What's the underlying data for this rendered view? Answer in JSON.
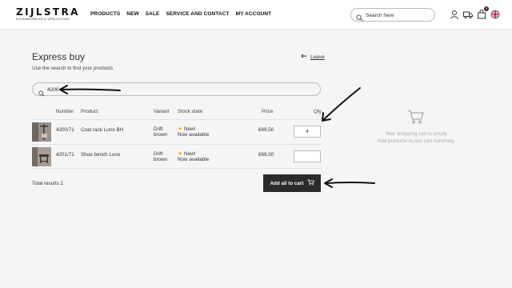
{
  "brand": {
    "name": "ZIJLSTRA",
    "tagline": "KLEINMEUBELEN & VERLICHTING"
  },
  "nav": [
    "PRODUCTS",
    "NEW",
    "SALE",
    "SERVICE AND CONTACT",
    "MY ACCOUNT"
  ],
  "header_search": {
    "placeholder": "Search here"
  },
  "header_icons": [
    "user-icon",
    "truck-icon",
    "cart-icon",
    "uk-flag-icon"
  ],
  "cart_badge": "0",
  "page": {
    "title": "Express buy",
    "subtitle": "Use the search to find your products",
    "leave_label": "Leave"
  },
  "search": {
    "value": "4200"
  },
  "table": {
    "headers": {
      "number": "Number",
      "product": "Product",
      "variant": "Variant",
      "stock": "Stock state",
      "price": "Price",
      "qty": "Qty"
    },
    "rows": [
      {
        "number": "4200/71",
        "product": "Coat rack Luno BH",
        "variant_line1": "Drift",
        "variant_line2": "brown",
        "stock_line1": "New!",
        "stock_line2": "Now available",
        "price": "€69,50",
        "qty": "4"
      },
      {
        "number": "4201/71",
        "product": "Shoe bench Luno",
        "variant_line1": "Drift",
        "variant_line2": "brown",
        "stock_line1": "New!",
        "stock_line2": "Now available",
        "price": "€69,50",
        "qty": ""
      }
    ]
  },
  "total_label": "Total results 2",
  "add_all_label": "Add all to cart",
  "empty_cart": {
    "line1": "Your shopping cart is empty",
    "line2": "Add products to see cart summary"
  },
  "colors": {
    "accent_dark": "#2b2b2b",
    "star": "#f0b400",
    "background": "#f5f5f5"
  }
}
